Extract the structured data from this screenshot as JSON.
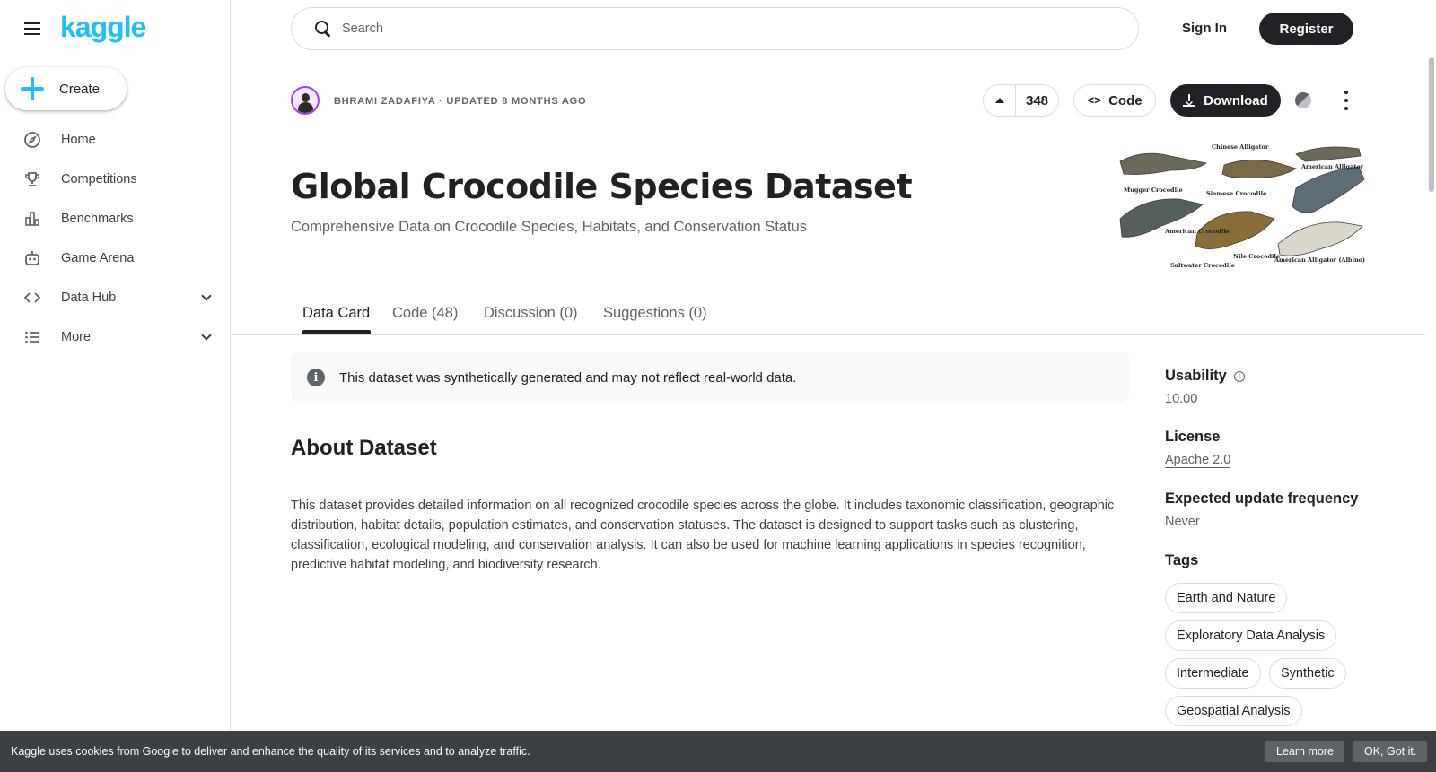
{
  "brand": {
    "logo_text": "kaggle",
    "accent": "#20beff"
  },
  "sidebar": {
    "create_label": "Create",
    "items": [
      {
        "label": "Home",
        "icon": "compass-icon"
      },
      {
        "label": "Competitions",
        "icon": "trophy-icon"
      },
      {
        "label": "Benchmarks",
        "icon": "bar-chart-icon"
      },
      {
        "label": "Game Arena",
        "icon": "robot-icon"
      },
      {
        "label": "Data Hub",
        "icon": "code-icon",
        "expandable": true
      },
      {
        "label": "More",
        "icon": "list-icon",
        "expandable": true
      }
    ]
  },
  "topbar": {
    "search_placeholder": "Search",
    "sign_in": "Sign In",
    "register": "Register"
  },
  "dataset": {
    "owner_line": "BHRAMI ZADAFIYA · UPDATED 8 MONTHS AGO",
    "upvotes": "348",
    "code_label": "Code",
    "download_label": "Download",
    "title": "Global Crocodile Species Dataset",
    "subtitle": "Comprehensive Data on Crocodile Species, Habitats, and Conservation Status",
    "cover_labels": [
      "Mugger Crocodile",
      "Chinese Alligator",
      "American Alligator",
      "Siamese Crocodile",
      "American Crocodile",
      "Nile Crocodile",
      "Saltwater Crocodile",
      "American Alligator (Albino)"
    ]
  },
  "tabs": [
    {
      "label": "Data Card",
      "active": true
    },
    {
      "label": "Code (48)",
      "active": false
    },
    {
      "label": "Discussion (0)",
      "active": false
    },
    {
      "label": "Suggestions (0)",
      "active": false
    }
  ],
  "notice": {
    "text": "This dataset was synthetically generated and may not reflect real-world data."
  },
  "about": {
    "heading": "About Dataset",
    "body": "This dataset provides detailed information on all recognized crocodile species across the globe. It includes taxonomic classification, geographic distribution, habitat details, population estimates, and conservation statuses. The dataset is designed to support tasks such as clustering, classification, ecological modeling, and conservation analysis. It can also be used for machine learning applications in species recognition, predictive habitat modeling, and biodiversity research."
  },
  "meta": {
    "usability_label": "Usability",
    "usability_value": "10.00",
    "license_label": "License",
    "license_value": "Apache 2.0",
    "frequency_label": "Expected update frequency",
    "frequency_value": "Never",
    "tags_label": "Tags",
    "tags": [
      "Earth and Nature",
      "Exploratory Data Analysis",
      "Intermediate",
      "Synthetic",
      "Geospatial Analysis"
    ]
  },
  "cookie": {
    "text": "Kaggle uses cookies from Google to deliver and enhance the quality of its services and to analyze traffic.",
    "learn_more": "Learn more",
    "ok": "OK, Got it."
  }
}
